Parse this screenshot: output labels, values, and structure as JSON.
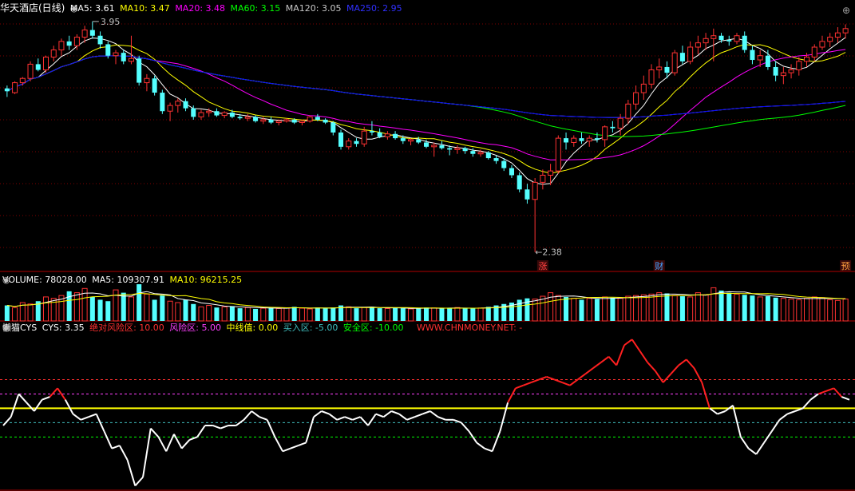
{
  "main": {
    "title": "华天酒店(日线)",
    "ma": [
      {
        "label": "MA5: 3.61",
        "color": "#ffffff"
      },
      {
        "label": "MA10: 3.47",
        "color": "#ffff00"
      },
      {
        "label": "MA20: 3.48",
        "color": "#ff00ff"
      },
      {
        "label": "MA60: 3.15",
        "color": "#00ff00"
      },
      {
        "label": "MA120: 3.05",
        "color": "#c8c8c8"
      },
      {
        "label": "MA250: 2.95",
        "color": "#0000ff"
      }
    ],
    "high_label": "3.95",
    "low_label": "2.38",
    "markers": [
      {
        "text": "涨",
        "color": "#ff4040"
      },
      {
        "text": "财",
        "color": "#40a0ff"
      },
      {
        "text": "预",
        "color": "#ffa040"
      }
    ]
  },
  "volume": {
    "label": "VOLUME: 78028.00",
    "ma5": "MA5: 109307.91",
    "ma10": "MA10: 96215.25",
    "ma10_color": "#ffff00"
  },
  "cys": {
    "name": "懒猫CYS",
    "value": "CYS: 3.35",
    "legend": [
      {
        "label": "绝对风险区: 10.00",
        "color": "#ff3030"
      },
      {
        "label": "风险区: 5.00",
        "color": "#ff40ff"
      },
      {
        "label": "中线值: 0.00",
        "color": "#ffff00"
      },
      {
        "label": "买入区: -5.00",
        "color": "#40c0c0"
      },
      {
        "label": "安全区: -10.00",
        "color": "#00ff00"
      }
    ],
    "watermark": "WWW.CHNMONEY.NET: -"
  },
  "chart_data": [
    {
      "type": "candlestick",
      "title": "华天酒店(日线)",
      "ylim": [
        2.3,
        4.05
      ],
      "candles": [
        [
          3.53,
          3.55,
          3.47,
          3.51
        ],
        [
          3.5,
          3.58,
          3.49,
          3.57
        ],
        [
          3.57,
          3.61,
          3.55,
          3.6
        ],
        [
          3.6,
          3.72,
          3.58,
          3.7
        ],
        [
          3.7,
          3.74,
          3.65,
          3.66
        ],
        [
          3.66,
          3.76,
          3.64,
          3.75
        ],
        [
          3.75,
          3.83,
          3.72,
          3.8
        ],
        [
          3.8,
          3.88,
          3.76,
          3.86
        ],
        [
          3.86,
          3.9,
          3.8,
          3.83
        ],
        [
          3.83,
          3.91,
          3.8,
          3.89
        ],
        [
          3.89,
          3.97,
          3.85,
          3.94
        ],
        [
          3.94,
          4.0,
          3.88,
          3.9
        ],
        [
          3.9,
          3.93,
          3.81,
          3.84
        ],
        [
          3.84,
          3.86,
          3.74,
          3.76
        ],
        [
          3.76,
          3.8,
          3.7,
          3.78
        ],
        [
          3.78,
          3.8,
          3.7,
          3.72
        ],
        [
          3.72,
          3.9,
          3.7,
          3.74
        ],
        [
          3.74,
          3.76,
          3.55,
          3.57
        ],
        [
          3.57,
          3.63,
          3.51,
          3.6
        ],
        [
          3.6,
          3.62,
          3.48,
          3.5
        ],
        [
          3.5,
          3.52,
          3.35,
          3.37
        ],
        [
          3.37,
          3.43,
          3.3,
          3.41
        ],
        [
          3.41,
          3.46,
          3.36,
          3.44
        ],
        [
          3.44,
          3.46,
          3.37,
          3.39
        ],
        [
          3.39,
          3.41,
          3.31,
          3.33
        ],
        [
          3.33,
          3.38,
          3.31,
          3.36
        ],
        [
          3.36,
          3.39,
          3.33,
          3.37
        ],
        [
          3.37,
          3.39,
          3.33,
          3.34
        ],
        [
          3.34,
          3.37,
          3.32,
          3.36
        ],
        [
          3.36,
          3.38,
          3.32,
          3.33
        ],
        [
          3.33,
          3.35,
          3.31,
          3.32
        ],
        [
          3.32,
          3.35,
          3.3,
          3.33
        ],
        [
          3.33,
          3.34,
          3.29,
          3.3
        ],
        [
          3.3,
          3.33,
          3.28,
          3.31
        ],
        [
          3.31,
          3.33,
          3.28,
          3.29
        ],
        [
          3.29,
          3.31,
          3.27,
          3.3
        ],
        [
          3.3,
          3.32,
          3.29,
          3.31
        ],
        [
          3.31,
          3.32,
          3.28,
          3.29
        ],
        [
          3.29,
          3.31,
          3.27,
          3.3
        ],
        [
          3.3,
          3.34,
          3.29,
          3.33
        ],
        [
          3.33,
          3.35,
          3.3,
          3.31
        ],
        [
          3.31,
          3.32,
          3.28,
          3.29
        ],
        [
          3.29,
          3.3,
          3.2,
          3.22
        ],
        [
          3.22,
          3.24,
          3.1,
          3.12
        ],
        [
          3.12,
          3.18,
          3.1,
          3.16
        ],
        [
          3.16,
          3.18,
          3.12,
          3.14
        ],
        [
          3.14,
          3.26,
          3.12,
          3.23
        ],
        [
          3.23,
          3.3,
          3.2,
          3.22
        ],
        [
          3.22,
          3.25,
          3.18,
          3.19
        ],
        [
          3.19,
          3.23,
          3.17,
          3.21
        ],
        [
          3.21,
          3.23,
          3.17,
          3.18
        ],
        [
          3.18,
          3.2,
          3.14,
          3.16
        ],
        [
          3.16,
          3.18,
          3.13,
          3.17
        ],
        [
          3.17,
          3.19,
          3.14,
          3.15
        ],
        [
          3.15,
          3.17,
          3.11,
          3.12
        ],
        [
          3.12,
          3.15,
          3.05,
          3.13
        ],
        [
          3.13,
          3.16,
          3.1,
          3.11
        ],
        [
          3.11,
          3.13,
          3.06,
          3.1
        ],
        [
          3.1,
          3.13,
          3.07,
          3.11
        ],
        [
          3.11,
          3.12,
          3.07,
          3.09
        ],
        [
          3.09,
          3.11,
          3.05,
          3.07
        ],
        [
          3.07,
          3.1,
          3.05,
          3.08
        ],
        [
          3.08,
          3.09,
          3.03,
          3.04
        ],
        [
          3.04,
          3.06,
          3.0,
          3.02
        ],
        [
          3.02,
          3.04,
          2.95,
          2.97
        ],
        [
          2.97,
          2.99,
          2.9,
          2.92
        ],
        [
          2.92,
          2.94,
          2.8,
          2.82
        ],
        [
          2.82,
          2.86,
          2.72,
          2.75
        ],
        [
          2.75,
          2.9,
          2.38,
          2.87
        ],
        [
          2.87,
          2.96,
          2.82,
          2.92
        ],
        [
          2.92,
          3.0,
          2.85,
          2.95
        ],
        [
          2.95,
          3.2,
          2.93,
          3.18
        ],
        [
          3.18,
          3.22,
          3.1,
          3.15
        ],
        [
          3.15,
          3.2,
          3.12,
          3.18
        ],
        [
          3.18,
          3.22,
          3.14,
          3.16
        ],
        [
          3.16,
          3.2,
          3.12,
          3.18
        ],
        [
          3.18,
          3.22,
          3.15,
          3.17
        ],
        [
          3.17,
          3.27,
          3.12,
          3.26
        ],
        [
          3.26,
          3.3,
          3.22,
          3.25
        ],
        [
          3.25,
          3.35,
          3.2,
          3.32
        ],
        [
          3.32,
          3.45,
          3.28,
          3.42
        ],
        [
          3.42,
          3.55,
          3.38,
          3.5
        ],
        [
          3.5,
          3.62,
          3.45,
          3.56
        ],
        [
          3.56,
          3.7,
          3.53,
          3.66
        ],
        [
          3.66,
          3.74,
          3.6,
          3.68
        ],
        [
          3.68,
          3.72,
          3.6,
          3.64
        ],
        [
          3.64,
          3.8,
          3.62,
          3.78
        ],
        [
          3.78,
          3.83,
          3.7,
          3.72
        ],
        [
          3.72,
          3.86,
          3.7,
          3.82
        ],
        [
          3.82,
          3.9,
          3.77,
          3.85
        ],
        [
          3.85,
          3.92,
          3.8,
          3.88
        ],
        [
          3.88,
          3.95,
          3.72,
          3.9
        ],
        [
          3.9,
          3.92,
          3.85,
          3.87
        ],
        [
          3.87,
          3.9,
          3.83,
          3.86
        ],
        [
          3.86,
          3.92,
          3.84,
          3.9
        ],
        [
          3.9,
          3.93,
          3.78,
          3.8
        ],
        [
          3.8,
          3.83,
          3.7,
          3.73
        ],
        [
          3.73,
          3.8,
          3.68,
          3.76
        ],
        [
          3.76,
          3.8,
          3.66,
          3.68
        ],
        [
          3.68,
          3.72,
          3.58,
          3.62
        ],
        [
          3.62,
          3.68,
          3.56,
          3.64
        ],
        [
          3.64,
          3.7,
          3.6,
          3.66
        ],
        [
          3.66,
          3.75,
          3.62,
          3.72
        ],
        [
          3.72,
          3.78,
          3.68,
          3.75
        ],
        [
          3.75,
          3.84,
          3.72,
          3.82
        ],
        [
          3.82,
          3.9,
          3.8,
          3.86
        ],
        [
          3.86,
          3.92,
          3.82,
          3.89
        ],
        [
          3.89,
          3.96,
          3.85,
          3.92
        ],
        [
          3.92,
          3.98,
          3.88,
          3.95
        ]
      ]
    },
    {
      "type": "bar",
      "title": "VOLUME",
      "values": [
        110,
        95,
        130,
        120,
        140,
        170,
        160,
        180,
        210,
        200,
        230,
        170,
        150,
        140,
        220,
        200,
        170,
        260,
        190,
        150,
        180,
        140,
        130,
        150,
        120,
        100,
        110,
        95,
        100,
        105,
        90,
        95,
        85,
        90,
        95,
        88,
        92,
        100,
        90,
        85,
        95,
        90,
        95,
        110,
        100,
        90,
        95,
        100,
        90,
        88,
        92,
        90,
        85,
        90,
        95,
        92,
        88,
        90,
        95,
        90,
        88,
        92,
        100,
        110,
        120,
        130,
        150,
        160,
        155,
        175,
        200,
        180,
        170,
        160,
        150,
        160,
        155,
        170,
        165,
        160,
        175,
        180,
        185,
        190,
        200,
        195,
        180,
        175,
        170,
        200,
        185,
        235,
        215,
        200,
        190,
        185,
        180,
        170,
        175,
        165,
        160,
        155,
        150,
        160,
        170,
        165,
        150,
        145,
        155,
        160
      ],
      "ylim": [
        0,
        260
      ]
    },
    {
      "type": "line",
      "title": "懒猫CYS",
      "series": [
        {
          "name": "CYS",
          "values": [
            -6,
            -3,
            5,
            2,
            -1,
            3,
            4,
            7,
            3,
            -2,
            -4,
            -3,
            -2,
            -8,
            -14,
            -13,
            -18,
            -27,
            -24,
            -7,
            -10,
            -15,
            -9,
            -14,
            -11,
            -10,
            -6,
            -6,
            -7,
            -6,
            -6,
            -4,
            -1,
            -3,
            -4,
            -10,
            -15,
            -14,
            -13,
            -12,
            -3,
            -1,
            -2,
            -4,
            -3,
            -4,
            -3,
            -6,
            -2,
            -3,
            -1,
            -2,
            -4,
            -3,
            -2,
            -1,
            -3,
            -4,
            -4,
            -5,
            -8,
            -12,
            -14,
            -15,
            -8,
            2,
            7,
            8,
            9,
            10,
            11,
            10,
            9,
            8,
            10,
            12,
            14,
            16,
            18,
            15,
            22,
            24,
            20,
            16,
            13,
            9,
            12,
            15,
            17,
            14,
            9,
            0,
            -2,
            -1,
            1,
            -10,
            -14,
            -16,
            -12,
            -8,
            -4,
            -2,
            -1,
            0,
            3,
            5,
            6,
            7,
            4,
            3
          ],
          "color": "#ffffff"
        }
      ],
      "reference_lines": [
        10,
        5,
        0,
        -5,
        -10
      ],
      "ylim": [
        -28,
        26
      ]
    }
  ]
}
